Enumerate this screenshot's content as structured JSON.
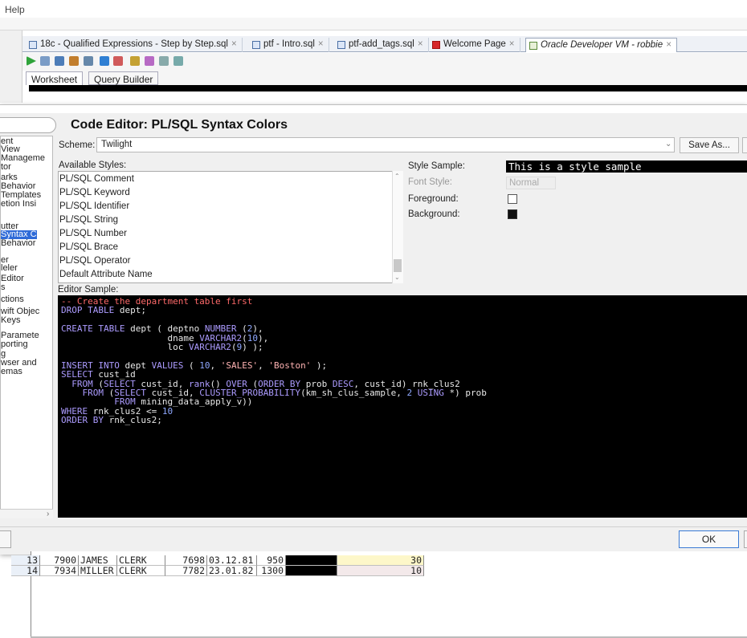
{
  "menubar": {
    "help": "Help"
  },
  "tabs": [
    {
      "label": "18c - Qualified Expressions - Step by Step.sql"
    },
    {
      "label": "ptf - Intro.sql"
    },
    {
      "label": "ptf-add_tags.sql"
    },
    {
      "label": "Welcome Page"
    },
    {
      "label": "Oracle Developer VM - robbie"
    }
  ],
  "worksheet_tabs": [
    "Worksheet",
    "Query Builder"
  ],
  "nav": {
    "items": [
      "ent",
      "View",
      "Manageme",
      "tor",
      "arks",
      "Behavior",
      "Templates",
      "etion Insi",
      "",
      "utter",
      "Syntax C",
      "Behavior",
      "er",
      "leler",
      "Editor",
      "s",
      "ctions",
      "wift Objec",
      "Keys",
      "Paramete",
      "porting",
      "g",
      "wser and",
      "emas"
    ],
    "selected": "Syntax C"
  },
  "panel": {
    "title": "Code Editor: PL/SQL Syntax Colors",
    "scheme_label": "Scheme:",
    "scheme_value": "Twilight",
    "save_as": "Save As...",
    "available_label": "Available Styles:",
    "styles": [
      "PL/SQL Comment",
      "PL/SQL Keyword",
      "PL/SQL Identifier",
      "PL/SQL String",
      "PL/SQL Number",
      "PL/SQL Brace",
      "PL/SQL Operator",
      "Default Attribute Name"
    ],
    "style_sample_label": "Style Sample:",
    "style_sample_text": "This is a style sample",
    "font_style_label": "Font Style:",
    "font_style_value": "Normal",
    "foreground_label": "Foreground:",
    "background_label": "Background:",
    "editor_sample_label": "Editor Sample:",
    "ok": "OK"
  },
  "code_lines": [
    [
      [
        "c",
        "-- Create the department table first"
      ]
    ],
    [
      [
        "k",
        "DROP TABLE "
      ],
      [
        "t",
        "dept;"
      ]
    ],
    [],
    [
      [
        "k",
        "CREATE TABLE "
      ],
      [
        "t",
        "dept ( deptno "
      ],
      [
        "k",
        "NUMBER "
      ],
      [
        "t",
        "("
      ],
      [
        "n",
        "2"
      ],
      [
        "t",
        "),"
      ]
    ],
    [
      [
        "t",
        "                    dname "
      ],
      [
        "k",
        "VARCHAR2"
      ],
      [
        "t",
        "("
      ],
      [
        "n",
        "10"
      ],
      [
        "t",
        "),"
      ]
    ],
    [
      [
        "t",
        "                    loc "
      ],
      [
        "k",
        "VARCHAR2"
      ],
      [
        "t",
        "("
      ],
      [
        "n",
        "9"
      ],
      [
        "t",
        ") );"
      ]
    ],
    [],
    [
      [
        "k",
        "INSERT INTO "
      ],
      [
        "t",
        "dept "
      ],
      [
        "k",
        "VALUES "
      ],
      [
        "t",
        "( "
      ],
      [
        "n",
        "10"
      ],
      [
        "t",
        ", "
      ],
      [
        "s",
        "'SALES'"
      ],
      [
        "t",
        ", "
      ],
      [
        "s",
        "'Boston'"
      ],
      [
        "t",
        " );"
      ]
    ],
    [
      [
        "k",
        "SELECT "
      ],
      [
        "t",
        "cust_id"
      ]
    ],
    [
      [
        "t",
        "  "
      ],
      [
        "k",
        "FROM "
      ],
      [
        "t",
        "("
      ],
      [
        "k",
        "SELECT "
      ],
      [
        "t",
        "cust_id, "
      ],
      [
        "k",
        "rank"
      ],
      [
        "t",
        "() "
      ],
      [
        "k",
        "OVER "
      ],
      [
        "t",
        "("
      ],
      [
        "k",
        "ORDER BY "
      ],
      [
        "t",
        "prob "
      ],
      [
        "k",
        "DESC"
      ],
      [
        "t",
        ", cust_id) rnk_clus2"
      ]
    ],
    [
      [
        "t",
        "    "
      ],
      [
        "k",
        "FROM "
      ],
      [
        "t",
        "("
      ],
      [
        "k",
        "SELECT "
      ],
      [
        "t",
        "cust_id, "
      ],
      [
        "k",
        "CLUSTER_PROBABILITY"
      ],
      [
        "t",
        "(km_sh_clus_sample, "
      ],
      [
        "n",
        "2 "
      ],
      [
        "k",
        "USING "
      ],
      [
        "t",
        "*) prob"
      ]
    ],
    [
      [
        "t",
        "          "
      ],
      [
        "k",
        "FROM "
      ],
      [
        "t",
        "mining_data_apply_v))"
      ]
    ],
    [
      [
        "k",
        "WHERE "
      ],
      [
        "t",
        "rnk_clus2 <= "
      ],
      [
        "n",
        "10"
      ]
    ],
    [
      [
        "k",
        "ORDER BY "
      ],
      [
        "t",
        "rnk_clus2;"
      ]
    ]
  ],
  "grid_rows": [
    {
      "row": "13",
      "empno": "7900",
      "ename": "JAMES",
      "job": "CLERK",
      "mgr": "7698",
      "hiredate": "03.12.81",
      "sal": "950",
      "deptno": "30"
    },
    {
      "row": "14",
      "empno": "7934",
      "ename": "MILLER",
      "job": "CLERK",
      "mgr": "7782",
      "hiredate": "23.01.82",
      "sal": "1300",
      "deptno": "10"
    }
  ]
}
